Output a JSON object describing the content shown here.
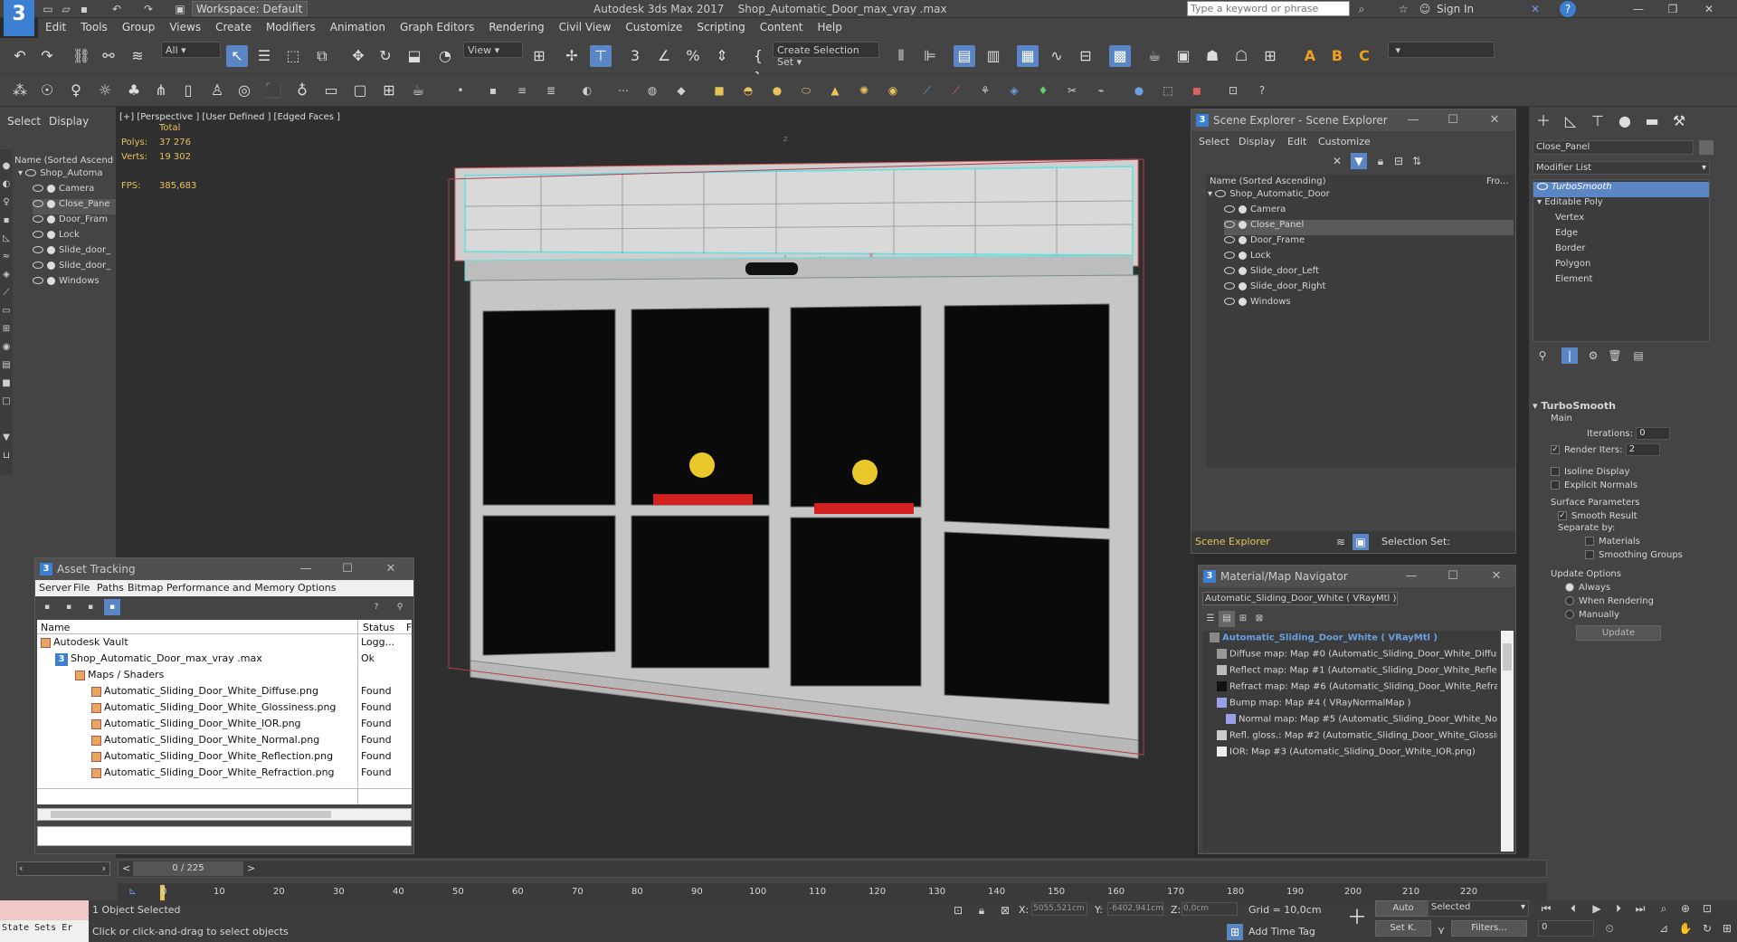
{
  "app": {
    "title": "Autodesk 3ds Max 2017",
    "file": "Shop_Automatic_Door_max_vray .max",
    "workspace": "Workspace: Default",
    "search_placeholder": "Type a keyword or phrase",
    "sign_in": "Sign In"
  },
  "menu": [
    "Edit",
    "Tools",
    "Group",
    "Views",
    "Create",
    "Modifiers",
    "Animation",
    "Graph Editors",
    "Rendering",
    "Civil View",
    "Customize",
    "Scripting",
    "Content",
    "Help"
  ],
  "toolbar": {
    "filter": "All",
    "view": "View",
    "selection_set": "Create Selection Set"
  },
  "left_panel": {
    "tabs": [
      "Select",
      "Display"
    ],
    "header": "Name (Sorted Ascend",
    "root": "Shop_Automa",
    "items": [
      "Camera",
      "Close_Pane",
      "Door_Fram",
      "Lock",
      "Slide_door_",
      "Slide_door_",
      "Windows"
    ]
  },
  "viewport": {
    "label": "[+] [Perspective ] [User Defined ] [Edged Faces ]",
    "stats_total": "Total",
    "polys_label": "Polys:",
    "polys": "37 276",
    "verts_label": "Verts:",
    "verts": "19 302",
    "fps_label": "FPS:",
    "fps": "385,683",
    "axis_x": "x",
    "axis_y": "y",
    "axis_z": "z"
  },
  "scene_explorer": {
    "title": "Scene Explorer - Scene Explorer",
    "menu": [
      "Select",
      "Display",
      "Edit",
      "Customize"
    ],
    "col_name": "Name (Sorted Ascending)",
    "col_fro": "Fro...",
    "root": "Shop_Automatic_Door",
    "items": [
      "Camera",
      "Close_Panel",
      "Door_Frame",
      "Lock",
      "Slide_door_Left",
      "Slide_door_Right",
      "Windows"
    ],
    "footer_name": "Scene Explorer",
    "selection_set": "Selection Set:"
  },
  "asset_tracking": {
    "title": "Asset Tracking",
    "menu": [
      "Server",
      "File",
      "Paths",
      "Bitmap Performance and Memory",
      "Options"
    ],
    "col_name": "Name",
    "col_status": "Status",
    "col_extra": "F",
    "rows": [
      {
        "name": "Autodesk Vault",
        "status": "Logg..."
      },
      {
        "name": "Shop_Automatic_Door_max_vray .max",
        "status": "Ok"
      },
      {
        "name": "Maps / Shaders",
        "status": ""
      },
      {
        "name": "Automatic_Sliding_Door_White_Diffuse.png",
        "status": "Found"
      },
      {
        "name": "Automatic_Sliding_Door_White_Glossiness.png",
        "status": "Found"
      },
      {
        "name": "Automatic_Sliding_Door_White_IOR.png",
        "status": "Found"
      },
      {
        "name": "Automatic_Sliding_Door_White_Normal.png",
        "status": "Found"
      },
      {
        "name": "Automatic_Sliding_Door_White_Reflection.png",
        "status": "Found"
      },
      {
        "name": "Automatic_Sliding_Door_White_Refraction.png",
        "status": "Found"
      }
    ]
  },
  "material_nav": {
    "title": "Material/Map Navigator",
    "current": "Automatic_Sliding_Door_White  ( VRayMtl )",
    "root": "Automatic_Sliding_Door_White  ( VRayMtl )",
    "items": [
      "Diffuse map: Map #0 (Automatic_Sliding_Door_White_Diffuse",
      "Reflect map: Map #1 (Automatic_Sliding_Door_White_Reflecti",
      "Refract map: Map #6 (Automatic_Sliding_Door_White_Refract",
      "Bump map: Map #4  ( VRayNormalMap )",
      "Normal map: Map #5 (Automatic_Sliding_Door_White_Norm",
      "Refl. gloss.: Map #2 (Automatic_Sliding_Door_White_Glossine",
      "IOR: Map #3 (Automatic_Sliding_Door_White_IOR.png)"
    ]
  },
  "modifier_panel": {
    "object_name": "Close_Panel",
    "modifier_list": "Modifier List",
    "stack": [
      "TurboSmooth",
      "Editable Poly",
      "Vertex",
      "Edge",
      "Border",
      "Polygon",
      "Element"
    ],
    "rollout": "TurboSmooth",
    "main": "Main",
    "iterations_label": "Iterations:",
    "iterations": "0",
    "render_iters_label": "Render Iters:",
    "render_iters": "2",
    "isoline": "Isoline Display",
    "explicit": "Explicit Normals",
    "surface": "Surface Parameters",
    "smooth_result": "Smooth Result",
    "separate": "Separate by:",
    "materials": "Materials",
    "smoothing": "Smoothing Groups",
    "update_options": "Update Options",
    "always": "Always",
    "when_rendering": "When Rendering",
    "manually": "Manually",
    "update": "Update"
  },
  "timeline": {
    "frame": "0 / 225",
    "ticks": [
      "0",
      "10",
      "20",
      "30",
      "40",
      "50",
      "60",
      "70",
      "80",
      "90",
      "100",
      "110",
      "120",
      "130",
      "140",
      "150",
      "160",
      "170",
      "180",
      "190",
      "200",
      "210",
      "220"
    ]
  },
  "status": {
    "state_sets": "State Sets Er",
    "selected": "1 Object Selected",
    "hint": "Click or click-and-drag to select objects",
    "x_label": "X:",
    "x": "5055,521cm",
    "y_label": "Y:",
    "y": "-6402,941cm",
    "z_label": "Z:",
    "z": "0,0cm",
    "grid": "Grid = 10,0cm",
    "add_time_tag": "Add Time Tag",
    "auto": "Auto",
    "set_k": "Set K.",
    "selected_dd": "Selected",
    "filters": "Filters...",
    "frame_field": "0"
  },
  "colors": {
    "accent": "#5b86c5",
    "highlight": "#4f7bd1",
    "bg": "#444444",
    "viewport": "#2f2f2f",
    "stats": "#e8c35a"
  }
}
